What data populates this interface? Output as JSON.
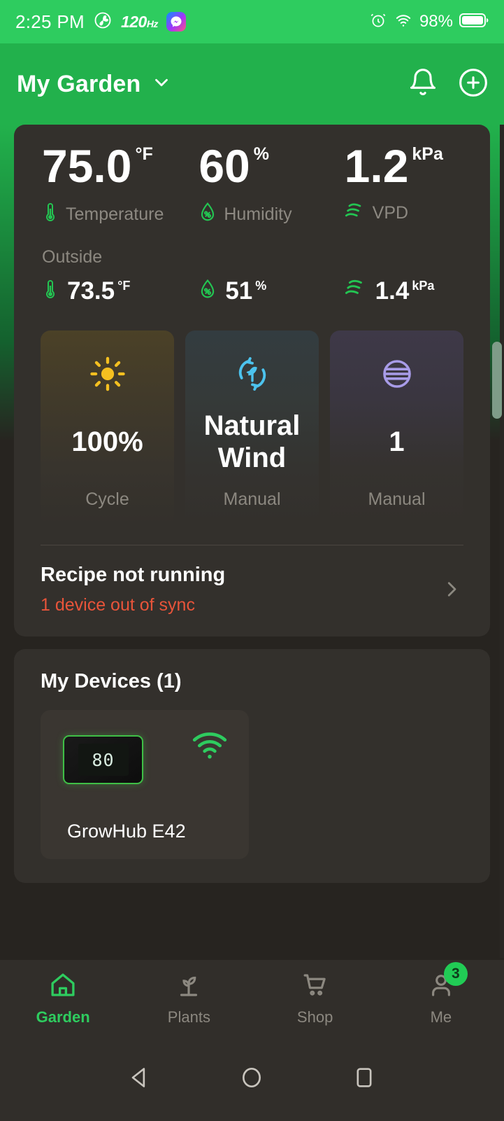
{
  "statusbar": {
    "time": "2:25 PM",
    "refresh_rate": "120",
    "refresh_unit": "Hz",
    "battery_percent": "98%",
    "icons": [
      "fan-icon",
      "messenger-icon",
      "alarm-icon",
      "wifi-icon",
      "battery-icon"
    ]
  },
  "header": {
    "title": "My Garden",
    "chevron": "chevron-down-icon",
    "bell": "notification-bell-icon",
    "add": "add-circle-icon"
  },
  "readings": {
    "inside": [
      {
        "value": "75.0",
        "unit": "°F",
        "label": "Temperature",
        "icon": "thermometer-icon"
      },
      {
        "value": "60",
        "unit": "%",
        "label": "Humidity",
        "icon": "humidity-drop-icon"
      },
      {
        "value": "1.2",
        "unit": "kPa",
        "label": "VPD",
        "icon": "vpd-waves-icon"
      }
    ],
    "outside_label": "Outside",
    "outside": [
      {
        "value": "73.5",
        "unit": "°F",
        "icon": "thermometer-icon"
      },
      {
        "value": "51",
        "unit": "%",
        "icon": "humidity-drop-icon"
      },
      {
        "value": "1.4",
        "unit": "kPa",
        "icon": "vpd-waves-icon"
      }
    ]
  },
  "tiles": [
    {
      "icon": "sun-icon",
      "value": "100%",
      "mode": "Cycle",
      "accent": "#f5c020"
    },
    {
      "icon": "natural-wind-icon",
      "value": "Natural Wind",
      "mode": "Manual",
      "accent": "#4cc3ee"
    },
    {
      "icon": "fan-speed-icon",
      "value": "1",
      "mode": "Manual",
      "accent": "#a89ce8"
    }
  ],
  "recipe": {
    "title": "Recipe not running",
    "status": "1 device out of sync",
    "status_color": "#e8543a",
    "chevron": "chevron-right-icon"
  },
  "devices": {
    "title": "My Devices (1)",
    "items": [
      {
        "name": "GrowHub E42",
        "display_value": "80",
        "wifi": "wifi-connected-icon",
        "wifi_color": "#2ecc5f"
      }
    ]
  },
  "bottom_nav": {
    "items": [
      {
        "label": "Garden",
        "icon": "home-icon",
        "active": true,
        "badge": ""
      },
      {
        "label": "Plants",
        "icon": "sprout-icon",
        "active": false,
        "badge": ""
      },
      {
        "label": "Shop",
        "icon": "cart-icon",
        "active": false,
        "badge": ""
      },
      {
        "label": "Me",
        "icon": "person-icon",
        "active": false,
        "badge": "3"
      }
    ],
    "active_color": "#2ecc5f",
    "inactive_color": "#8c8880"
  },
  "android_nav": {
    "back": "back-triangle-icon",
    "home": "home-circle-icon",
    "recents": "recents-square-icon"
  }
}
